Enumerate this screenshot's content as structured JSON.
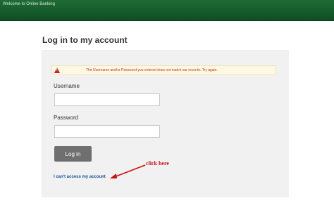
{
  "header": {
    "title": "Welcome to Online Banking"
  },
  "page": {
    "title": "Log in to my account"
  },
  "alert": {
    "icon": "warning-icon",
    "message": "The Username and/or Password you entered does not match our records. Try again."
  },
  "form": {
    "username_label": "Username",
    "username_value": "",
    "password_label": "Password",
    "password_value": "",
    "login_label": "Log in",
    "access_link": "I can't access my account"
  },
  "annotation": {
    "text": "click here"
  },
  "colors": {
    "header_green": "#1f6b35",
    "alert_red": "#cc3322",
    "link_blue": "#1a4fa3",
    "button_gray": "#6f6f6f",
    "annotation_red": "#cc1010"
  }
}
